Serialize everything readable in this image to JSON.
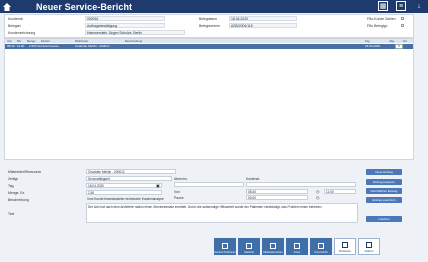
{
  "header": {
    "title": "Neuer Service-Bericht"
  },
  "info": {
    "kunde_label": "Kundendr.",
    "kunde_value": "000016",
    "belegart_label": "Belegart",
    "belegart_value": "Auftragsbestätigung",
    "kundenzeichnung_label": "Kundenzeichnung",
    "kundenzeichnung_value": "Hammerstein Jürgen Schulze, Berlin",
    "belegdatum_label": "Belegdatum",
    "belegdatum_value": "18.04.2020",
    "belegnummer_label": "Belegnummer",
    "belegnummer_value": "ASB/2004/115",
    "fbo_kunde_label": "FBo-Kunde Zahlen",
    "fbo_belegtyp_label": "FBo Belegtyp"
  },
  "grid": {
    "columns": [
      "Von",
      "Bis",
      "Menge",
      "Einheit",
      "Mitarbeiter",
      "Beschreibung",
      "Tag",
      "Abg.",
      "Ort"
    ],
    "rows": [
      {
        "von": "08:30",
        "bis": "11:00",
        "einheit": "2.50h Servicetrimesse",
        "mitarbeiter": "Charlotte Mehlin - 000012",
        "tag": "18.04.2020"
      }
    ],
    "row_button": "✕"
  },
  "form": {
    "mitarbeiter_label": "Mitarbeiter/Ressource",
    "mitarbeiter_value": "Charlotte Mehlin - 000012",
    "zeitzyp_label": "Zeittyp",
    "zeitzyp_value": "Servicetätigkeit",
    "tag_label": "Tag",
    "tag_value": "18.04.2020",
    "menge_label": "Menge, Ez.",
    "menge_value": "2,50",
    "beschreibung_label": "Beschreibung",
    "beschreibung_value": "Vom Kunde beanstandeter technische Kundenanalyse",
    "text_label": "Text",
    "text_value": "Der Arzt hat nach dem Anlieferte radion einen Serviceeinsatz ermittelt. Durch die aufwendige Hilfsarbeit wurde der Patienten verständigt, das Problem einen beheben.",
    "abrechnung_label": "Abrechn.",
    "kostenstelle_label": "Kostenst.",
    "von_label": "Von",
    "von_value": "08:30",
    "bis_value": "11:00",
    "pause_label": "Pause",
    "pause_value": "00:00",
    "abrech_value": "",
    "kosten_value": ""
  },
  "side_buttons": [
    "Neue Eintrag",
    "Eintrag kopieren",
    "Durchfahren Eintrag",
    "Eintrag speichern",
    "Löschen"
  ],
  "bottom_bar": [
    {
      "label": "Service Positionen",
      "light": false
    },
    {
      "label": "Material",
      "light": false
    },
    {
      "label": "Mitarbeiterzeiten",
      "light": false
    },
    {
      "label": "Fotos",
      "light": false
    },
    {
      "label": "Unterschrift",
      "light": false
    },
    {
      "label": "Positionen",
      "light": true
    },
    {
      "label": "Notizen",
      "light": true
    }
  ]
}
